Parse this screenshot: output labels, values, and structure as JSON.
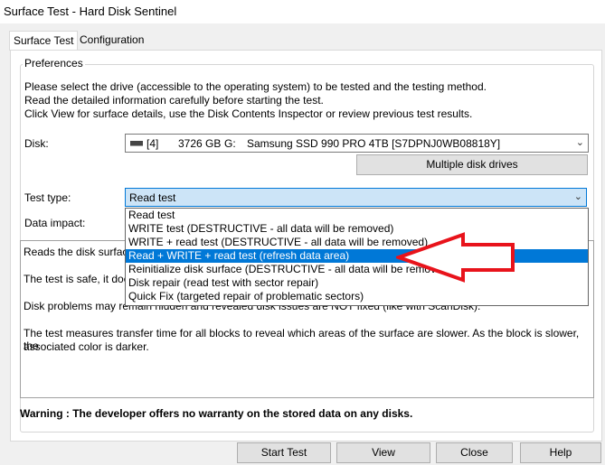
{
  "window": {
    "title": "Surface Test - Hard Disk Sentinel"
  },
  "tabs": [
    {
      "label": "Surface Test"
    },
    {
      "label": "Configuration"
    }
  ],
  "preferences": {
    "group_label": "Preferences",
    "intro": [
      "Please select the drive (accessible to the operating system) to be tested and the testing method.",
      "Read the detailed information carefully before starting the test.",
      "Click View for surface details, use the Disk Contents Inspector or review previous test results."
    ],
    "disk_label": "Disk:",
    "disk": {
      "index": "[4]",
      "size": "3726 GB",
      "letter": "G:",
      "model": "Samsung SSD 990 PRO 4TB [S7DPNJ0WB08818Y]"
    },
    "multiple_drives_label": "Multiple disk drives",
    "test_type_label": "Test type:",
    "test_type_value": "Read test",
    "data_impact_label": "Data impact:",
    "test_type_options": [
      "Read test",
      "WRITE test (DESTRUCTIVE - all data will be removed)",
      "WRITE + read test (DESTRUCTIVE - all data will be removed)",
      "Read + WRITE + read test (refresh data area)",
      "Reinitialize disk surface (DESTRUCTIVE - all data will be removed)",
      "Disk repair (read test with sector repair)",
      "Quick Fix (targeted repair of problematic sectors)"
    ],
    "selected_option_index": 3,
    "description": {
      "line1": "Reads the disk surface",
      "line2": "The test is safe, it doe",
      "line3": "Disk problems may remain hidden and revealed disk issues are NOT fixed (like with ScanDisk).",
      "line4a": "The test measures transfer time for all blocks to reveal which areas of the surface are slower. As the block is slower, the",
      "line4b": "associated color is darker."
    },
    "warning": "Warning : The developer offers no warranty on the stored data on any disks."
  },
  "buttons": {
    "start_test": "Start Test",
    "view": "View",
    "close": "Close",
    "help": "Help"
  },
  "colors": {
    "selection": "#0078d7",
    "arrow": "#e8131b"
  }
}
